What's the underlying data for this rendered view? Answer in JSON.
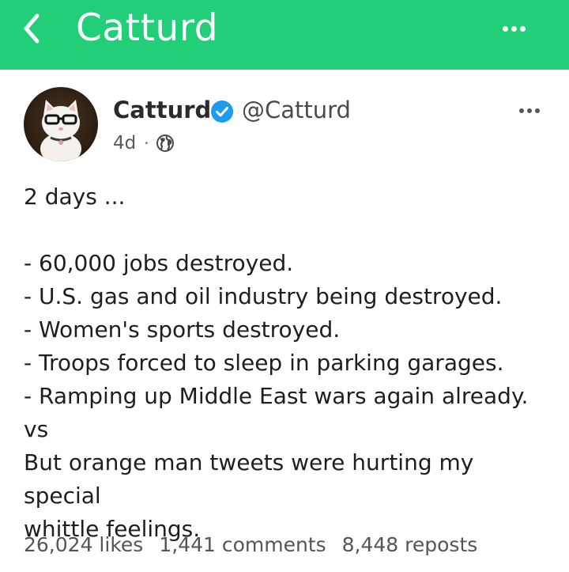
{
  "appbar": {
    "title": "Catturd",
    "back_icon": "chevron-left-icon",
    "menu_icon": "more-horizontal-icon",
    "color": "#22cf78"
  },
  "post": {
    "display_name": "Catturd",
    "handle": "@Catturd",
    "verified": true,
    "verified_color": "#1d9bf0",
    "time": "4d",
    "separator": "·",
    "visibility_icon": "globe-icon",
    "avatar_icon": "cat-with-glasses-avatar",
    "lines": [
      "2 days ...",
      "",
      "- 60,000 jobs destroyed.",
      "- U.S. gas and oil industry being destroyed.",
      "- Women's sports destroyed.",
      "- Troops forced to sleep in parking garages.",
      "- Ramping up Middle East wars again already.",
      "vs",
      "But orange man tweets were hurting my special",
      "whittle feelings."
    ],
    "stats": {
      "likes": "26,024 likes",
      "comments": "1,441 comments",
      "reposts": "8,448 reposts"
    }
  }
}
